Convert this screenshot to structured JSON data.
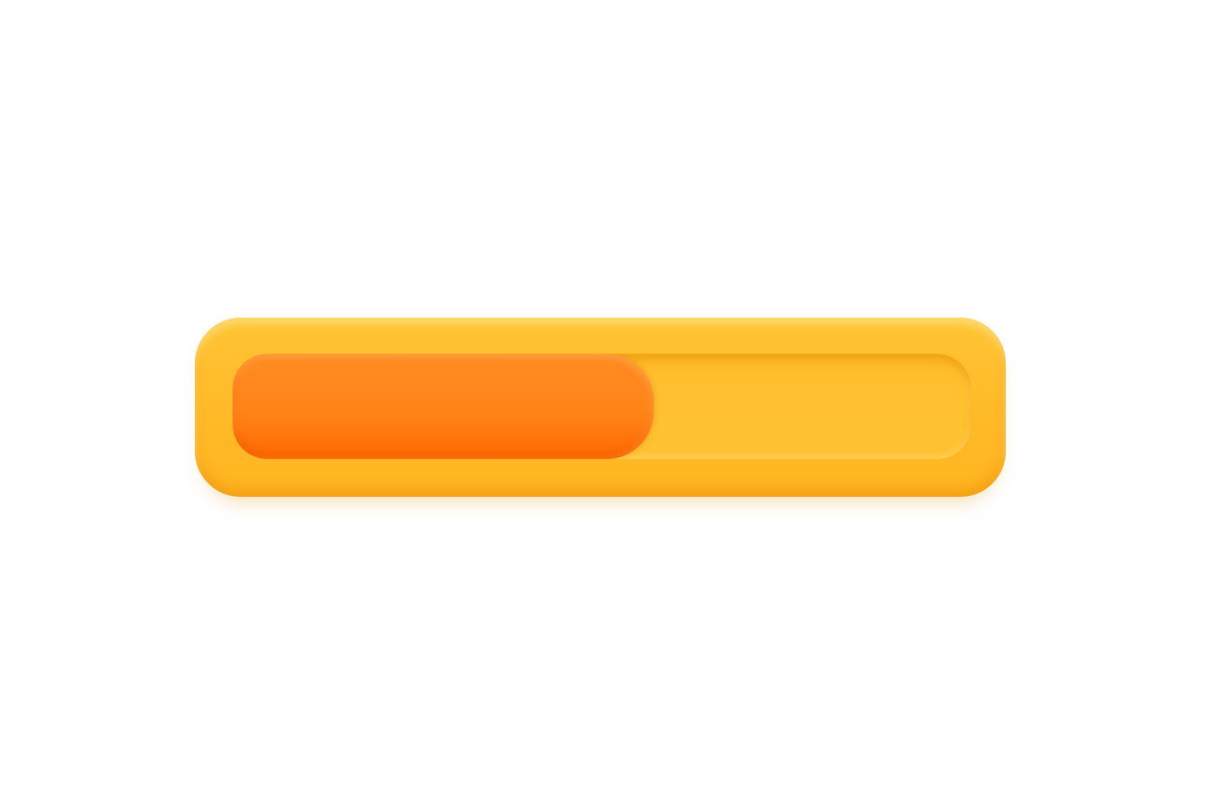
{
  "progress_bar": {
    "value": 0.57,
    "colors": {
      "frame": "#FFBA28",
      "track": "#FFC02E",
      "fill": "#FF8418",
      "fill_dark": "#FF6A00",
      "background": "#FFFFFF"
    }
  }
}
